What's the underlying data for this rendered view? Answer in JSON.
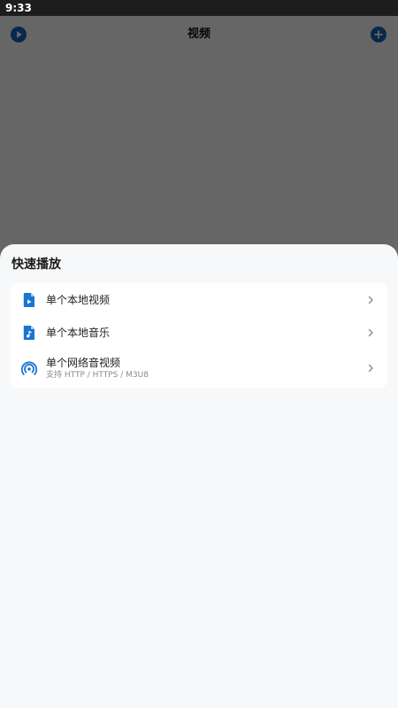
{
  "status_bar": {
    "time": "9:33"
  },
  "header": {
    "title": "视频",
    "left_icon": "play-circle-icon",
    "right_icon": "add-circle-icon"
  },
  "sheet": {
    "title": "快速播放",
    "items": [
      {
        "label": "单个本地视频",
        "icon": "video-file-icon"
      },
      {
        "label": "单个本地音乐",
        "icon": "music-file-icon"
      },
      {
        "label": "单个网络音视频",
        "subtitle": "支持 HTTP / HTTPS / M3U8",
        "icon": "broadcast-icon"
      }
    ]
  },
  "colors": {
    "accent": "#1565c0",
    "icon_blue": "#1976d2",
    "sheet_bg": "#f7f8fa",
    "card_bg": "#ffffff"
  }
}
